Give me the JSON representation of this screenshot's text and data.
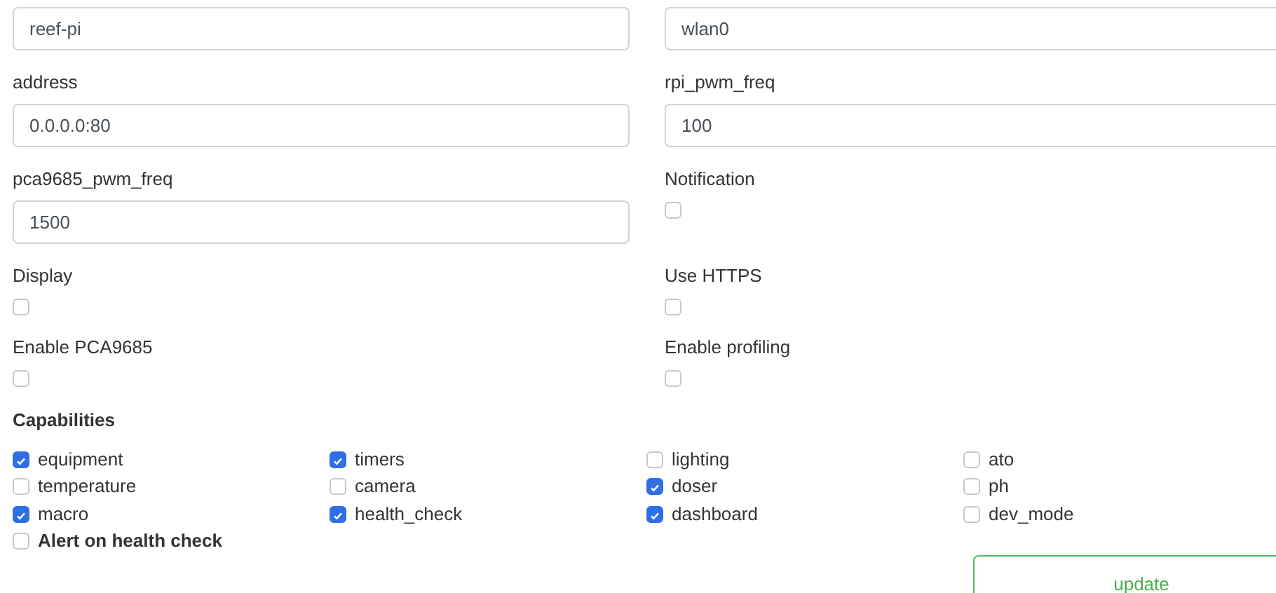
{
  "settings": [
    {
      "kind": "text",
      "value": "reef-pi"
    },
    {
      "kind": "text",
      "value": "wlan0"
    },
    {
      "kind": "text",
      "label": "address",
      "value": "0.0.0.0:80"
    },
    {
      "kind": "text",
      "label": "rpi_pwm_freq",
      "value": "100"
    },
    {
      "kind": "text",
      "label": "pca9685_pwm_freq",
      "value": "1500"
    },
    {
      "kind": "checkbox",
      "label": "Notification",
      "checked": false
    },
    {
      "kind": "checkbox",
      "label": "Display",
      "checked": false
    },
    {
      "kind": "checkbox",
      "label": "Use HTTPS",
      "checked": false
    },
    {
      "kind": "checkbox",
      "label": "Enable PCA9685",
      "checked": false
    },
    {
      "kind": "checkbox",
      "label": "Enable profiling",
      "checked": false
    }
  ],
  "capabilities": {
    "title": "Capabilities",
    "items": [
      {
        "label": "equipment",
        "checked": true
      },
      {
        "label": "timers",
        "checked": true
      },
      {
        "label": "lighting",
        "checked": false
      },
      {
        "label": "ato",
        "checked": false
      },
      {
        "label": "temperature",
        "checked": false
      },
      {
        "label": "camera",
        "checked": false
      },
      {
        "label": "doser",
        "checked": true
      },
      {
        "label": "ph",
        "checked": false
      },
      {
        "label": "macro",
        "checked": true
      },
      {
        "label": "health_check",
        "checked": true
      },
      {
        "label": "dashboard",
        "checked": true
      },
      {
        "label": "dev_mode",
        "checked": false
      }
    ],
    "alert": {
      "label": "Alert on health check",
      "checked": false
    }
  },
  "update_button": "update"
}
